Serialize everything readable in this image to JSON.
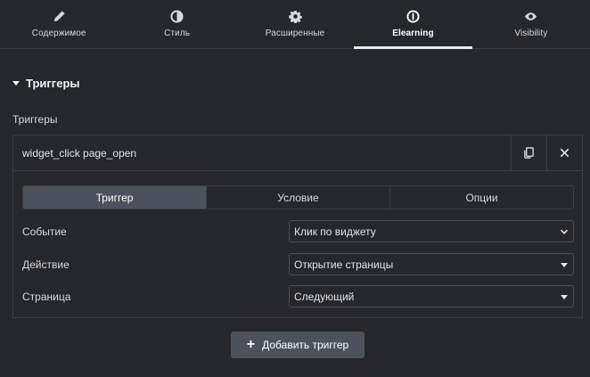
{
  "tabs": [
    {
      "label": "Содержимое",
      "icon": "pencil-icon",
      "active": false
    },
    {
      "label": "Стиль",
      "icon": "half-circle-icon",
      "active": false
    },
    {
      "label": "Расширенные",
      "icon": "gear-icon",
      "active": false
    },
    {
      "label": "Elearning",
      "icon": "info-circle-icon",
      "active": true
    },
    {
      "label": "Visibility",
      "icon": "eye-icon",
      "active": false
    }
  ],
  "section": {
    "title": "Триггеры"
  },
  "field": {
    "label": "Триггеры"
  },
  "repeater": {
    "item_title": "widget_click page_open",
    "inner_tabs": [
      "Триггер",
      "Условие",
      "Опции"
    ],
    "rows": [
      {
        "label": "Событие",
        "value": "Клик по виджету"
      },
      {
        "label": "Действие",
        "value": "Открытие страницы"
      },
      {
        "label": "Страница",
        "value": "Следующий"
      }
    ]
  },
  "add_button": {
    "label": "Добавить триггер"
  },
  "colors": {
    "background": "#25272c",
    "active_tab": "#4c525d",
    "border": "#3a3d44"
  }
}
